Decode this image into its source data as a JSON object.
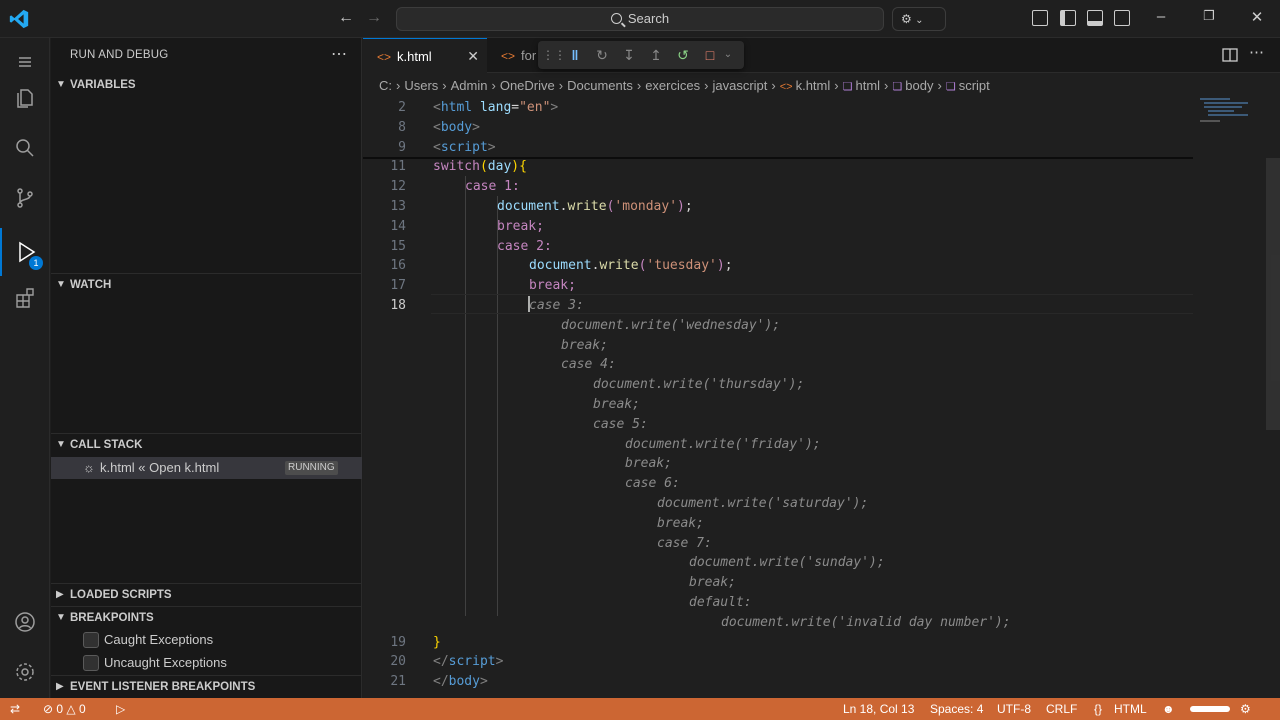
{
  "titlebar": {
    "search_placeholder": "Search",
    "back_icon": "arrow-left-icon",
    "forward_icon": "arrow-right-icon"
  },
  "activity": {
    "debug_badge": "1"
  },
  "sidebar": {
    "title": "RUN AND DEBUG",
    "sections": {
      "variables": "VARIABLES",
      "watch": "WATCH",
      "call_stack": "CALL STACK",
      "loaded_scripts": "LOADED SCRIPTS",
      "breakpoints": "BREAKPOINTS",
      "event_listener_breakpoints": "EVENT LISTENER BREAKPOINTS"
    },
    "call_stack_item": {
      "label": "k.html « Open k.html",
      "status": "RUNNING"
    },
    "breakpoint_items": [
      "Caught Exceptions",
      "Uncaught Exceptions"
    ]
  },
  "editor": {
    "tabs": [
      {
        "label": "k.html",
        "active": true
      },
      {
        "label": "for",
        "active": false
      }
    ],
    "breadcrumb": [
      "C:",
      "Users",
      "Admin",
      "OneDrive",
      "Documents",
      "exercices",
      "javascript",
      "k.html",
      "html",
      "body",
      "script"
    ],
    "line_numbers": [
      "2",
      "8",
      "9",
      "11",
      "12",
      "13",
      "14",
      "15",
      "16",
      "17",
      "18",
      "19",
      "20",
      "21"
    ],
    "ghost_lines": [
      "case 3:",
      "document.write('wednesday');",
      "break;",
      "case 4:",
      "document.write('thursday');",
      "break;",
      "case 5:",
      "document.write('friday');",
      "break;",
      "case 6:",
      "document.write('saturday');",
      "break;",
      "case 7:",
      "document.write('sunday');",
      "break;",
      "default:",
      "document.write('invalid day number');"
    ],
    "code": {
      "l2_tag": "html",
      "l2_attr": "lang",
      "l2_val": "\"en\"",
      "l8_tag": "body",
      "l9_tag": "script",
      "l11_kw": "switch",
      "l11_var": "day",
      "l12": "case 1:",
      "l13_obj": "document",
      "l13_fn": "write",
      "l13_str": "'monday'",
      "l14": "break;",
      "l15": "case 2:",
      "l16_obj": "document",
      "l16_fn": "write",
      "l16_str": "'tuesday'",
      "l17": "break;",
      "l20_tag": "script",
      "l21_tag": "body"
    }
  },
  "statusbar": {
    "errors": "0",
    "warnings": "0",
    "position": "Ln 18, Col 13",
    "spaces": "Spaces: 4",
    "encoding": "UTF-8",
    "eol": "CRLF",
    "language": "HTML",
    "color": "#cc6633"
  }
}
